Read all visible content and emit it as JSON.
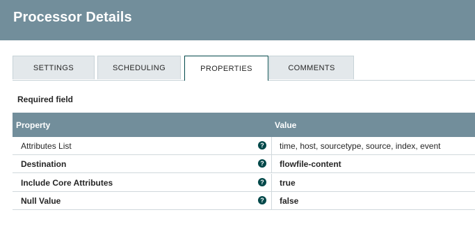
{
  "header": {
    "title": "Processor Details"
  },
  "tabs": [
    {
      "label": "SETTINGS",
      "active": false
    },
    {
      "label": "SCHEDULING",
      "active": false
    },
    {
      "label": "PROPERTIES",
      "active": true
    },
    {
      "label": "COMMENTS",
      "active": false
    }
  ],
  "properties": {
    "required_label": "Required field",
    "columns": {
      "property": "Property",
      "value": "Value"
    },
    "rows": [
      {
        "name": "Attributes List",
        "value": "time, host, sourcetype, source, index, event",
        "required": false,
        "help_icon": "?"
      },
      {
        "name": "Destination",
        "value": "flowfile-content",
        "required": true,
        "help_icon": "?"
      },
      {
        "name": "Include Core Attributes",
        "value": "true",
        "required": true,
        "help_icon": "?"
      },
      {
        "name": "Null Value",
        "value": "false",
        "required": true,
        "help_icon": "?"
      }
    ]
  },
  "colors": {
    "header_bg": "#728e9b",
    "active_tab_border": "#004849",
    "tab_bg": "#e3e8eb",
    "help_icon_bg": "#004849"
  }
}
